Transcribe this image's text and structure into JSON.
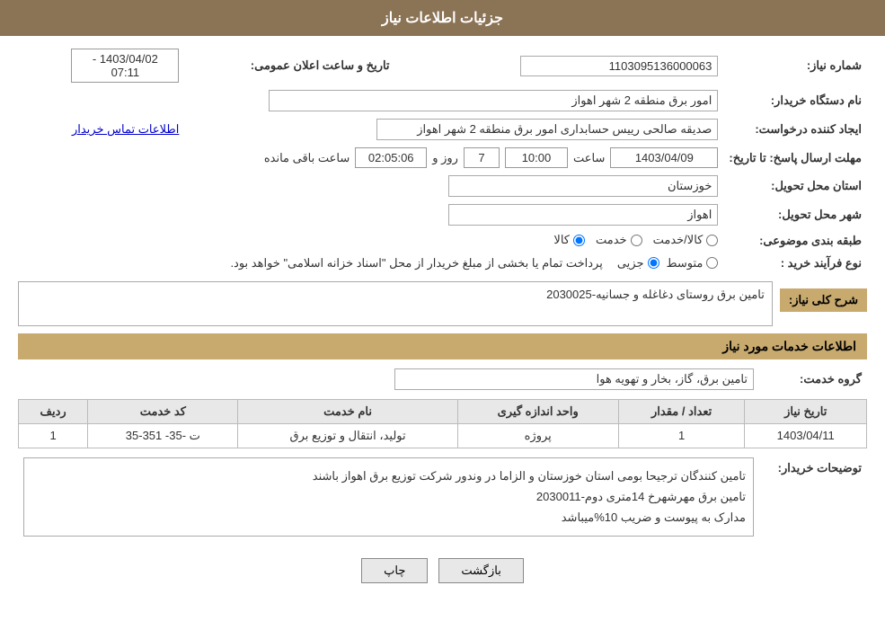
{
  "header": {
    "title": "جزئیات اطلاعات نیاز"
  },
  "fields": {
    "need_number_label": "شماره نیاز:",
    "need_number_value": "1103095136000063",
    "buyer_org_label": "نام دستگاه خریدار:",
    "buyer_org_value": "امور برق منطقه 2 شهر اهواز",
    "creator_label": "ایجاد کننده درخواست:",
    "creator_value": "صدیقه صالحی رییس حسابداری امور برق منطقه 2 شهر اهواز",
    "contact_link": "اطلاعات تماس خریدار",
    "deadline_label": "مهلت ارسال پاسخ: تا تاریخ:",
    "deadline_date": "1403/04/09",
    "deadline_time_label": "ساعت",
    "deadline_time": "10:00",
    "deadline_day_label": "روز و",
    "deadline_days": "7",
    "deadline_remaining_label": "ساعت باقی مانده",
    "deadline_remaining": "02:05:06",
    "announce_label": "تاریخ و ساعت اعلان عمومی:",
    "announce_value": "1403/04/02 - 07:11",
    "province_label": "استان محل تحویل:",
    "province_value": "خوزستان",
    "city_label": "شهر محل تحویل:",
    "city_value": "اهواز",
    "category_label": "طبقه بندی موضوعی:",
    "category_kala": "کالا",
    "category_khadamat": "خدمت",
    "category_kala_khadamat": "کالا/خدمت",
    "category_selected": "کالا",
    "purchase_type_label": "نوع فرآیند خرید :",
    "purchase_jozvi": "جزیی",
    "purchase_motavaset": "متوسط",
    "purchase_description": "پرداخت تمام یا بخشی از مبلغ خریدار از محل \"اسناد خزانه اسلامی\" خواهد بود.",
    "need_description_label": "شرح کلی نیاز:",
    "need_description_value": "تامین برق روستای دغاغله و جسانیه-2030025",
    "services_info_label": "اطلاعات خدمات مورد نیاز",
    "service_group_label": "گروه خدمت:",
    "service_group_value": "تامین برق، گاز، بخار و تهویه هوا",
    "table_headers": {
      "row_num": "ردیف",
      "service_code": "کد خدمت",
      "service_name": "نام خدمت",
      "unit": "واحد اندازه گیری",
      "quantity": "تعداد / مقدار",
      "date": "تاریخ نیاز"
    },
    "table_rows": [
      {
        "row_num": "1",
        "service_code": "ت -35- 351-35",
        "service_name": "تولید، انتقال و توزیع برق",
        "unit": "پروژه",
        "quantity": "1",
        "date": "1403/04/11"
      }
    ],
    "buyer_desc_label": "توضیحات خریدار:",
    "buyer_desc_value": "تامین کنندگان ترجیحا بومی استان خوزستان  و الزاما در وندور شرکت توزیع برق اهواز باشند\nتامین برق مهرشهرخ 14متری دوم-2030011\nمدارک به پیوست و ضریب 10%میباشد",
    "btn_back": "بازگشت",
    "btn_print": "چاپ"
  }
}
